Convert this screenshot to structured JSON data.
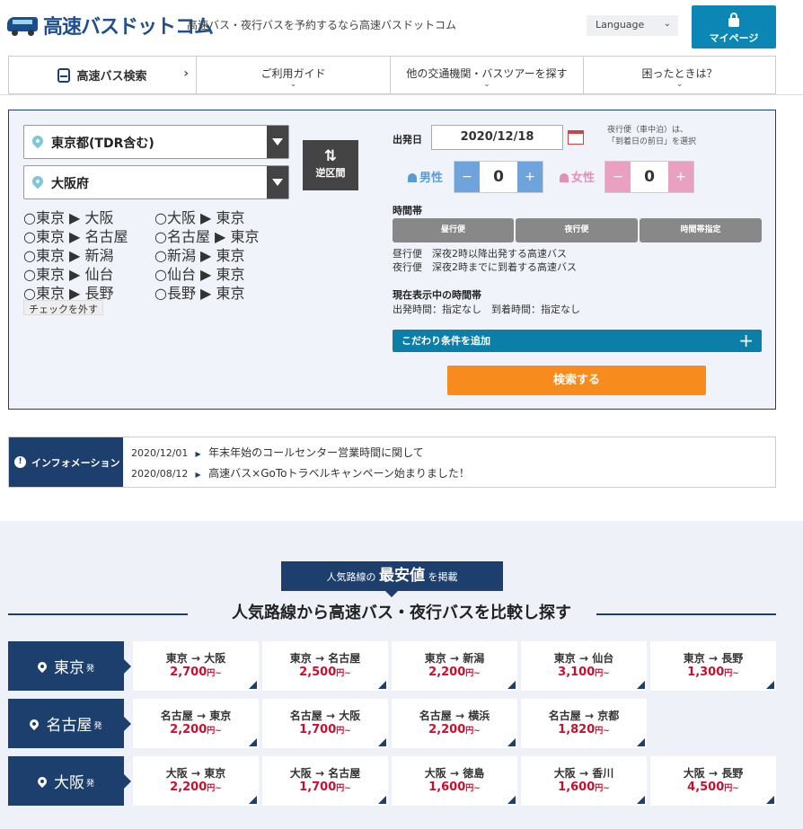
{
  "header": {
    "logo_text": "高速バスドットコム",
    "tagline": "高速バス・夜行バスを予約するなら高速バスドットコム",
    "language_label": "Language",
    "mypage_label": "マイページ"
  },
  "nav": [
    {
      "label": "高速バス検索",
      "icon": "bus-icon",
      "arrow": "›"
    },
    {
      "label": "ご利用ガイド",
      "arrow": "⌄"
    },
    {
      "label": "他の交通機関・バスツアーを探す",
      "arrow": "⌄"
    },
    {
      "label": "困ったときは？",
      "arrow": "⌄"
    }
  ],
  "search": {
    "departure": "東京都(TDR含む)",
    "arrival": "大阪府",
    "swap_label": "逆区間",
    "swap_icon": "⇅",
    "routes_left": [
      "東京 ▶ 大阪",
      "東京 ▶ 名古屋",
      "東京 ▶ 新潟",
      "東京 ▶ 仙台",
      "東京 ▶ 長野"
    ],
    "routes_right": [
      "大阪 ▶ 東京",
      "名古屋 ▶ 東京",
      "新潟 ▶ 東京",
      "仙台 ▶ 東京",
      "長野 ▶ 東京"
    ],
    "uncheck_label": "チェックを外す",
    "date_label": "出発日",
    "date_value": "2020/12/18",
    "date_note_1": "夜行便（車中泊）は、",
    "date_note_2": "「到着日の前日」を選択",
    "male_label": "男性",
    "male_count": "0",
    "female_label": "女性",
    "female_count": "0",
    "minus": "−",
    "plus": "+",
    "time_label": "時間帯",
    "time_buttons": [
      "昼行便",
      "夜行便",
      "時間帯指定"
    ],
    "desc_1": "昼行便　深夜2時以降出発する高速バス",
    "desc_2": "夜行便　深夜2時までに到着する高速バス",
    "current_label": "現在表示中の時間帯",
    "current_value": "出発時間：指定なし　到着時間：指定なし",
    "add_condition_label": "こだわり条件を追加",
    "add_condition_plus": "+",
    "search_button_label": "検索する",
    "colors": {
      "male": "#5b9bd5",
      "female": "#e58fb4",
      "accent": "#f78b1e"
    }
  },
  "info": {
    "title": "インフォメーション",
    "icon": "!",
    "items": [
      {
        "date": "2020/12/01",
        "text": "年末年始のコールセンター営業時間に関して"
      },
      {
        "date": "2020/08/12",
        "text": "高速バス×GoToトラベルキャンペーン始まりました！"
      }
    ]
  },
  "popular": {
    "badge_pre": "人気路線の",
    "badge_big": "最安値",
    "badge_post": "を掲載",
    "heading": "人気路線から高速バス・夜行バスを比較し探す",
    "suffix": "発",
    "yen_suffix": "円~",
    "groups": [
      {
        "origin": "東京",
        "cards": [
          {
            "route": "東京 → 大阪",
            "price": "2,700"
          },
          {
            "route": "東京 → 名古屋",
            "price": "2,500"
          },
          {
            "route": "東京 → 新潟",
            "price": "2,200"
          },
          {
            "route": "東京 → 仙台",
            "price": "3,100"
          },
          {
            "route": "東京 → 長野",
            "price": "1,300"
          }
        ]
      },
      {
        "origin": "名古屋",
        "cards": [
          {
            "route": "名古屋 → 東京",
            "price": "2,200"
          },
          {
            "route": "名古屋 → 大阪",
            "price": "1,700"
          },
          {
            "route": "名古屋 → 横浜",
            "price": "2,200"
          },
          {
            "route": "名古屋 → 京都",
            "price": "1,820"
          }
        ]
      },
      {
        "origin": "大阪",
        "cards": [
          {
            "route": "大阪 → 東京",
            "price": "2,200"
          },
          {
            "route": "大阪 → 名古屋",
            "price": "1,700"
          },
          {
            "route": "大阪 → 徳島",
            "price": "1,600"
          },
          {
            "route": "大阪 → 香川",
            "price": "1,600"
          },
          {
            "route": "大阪 → 長野",
            "price": "4,500"
          }
        ]
      }
    ]
  }
}
